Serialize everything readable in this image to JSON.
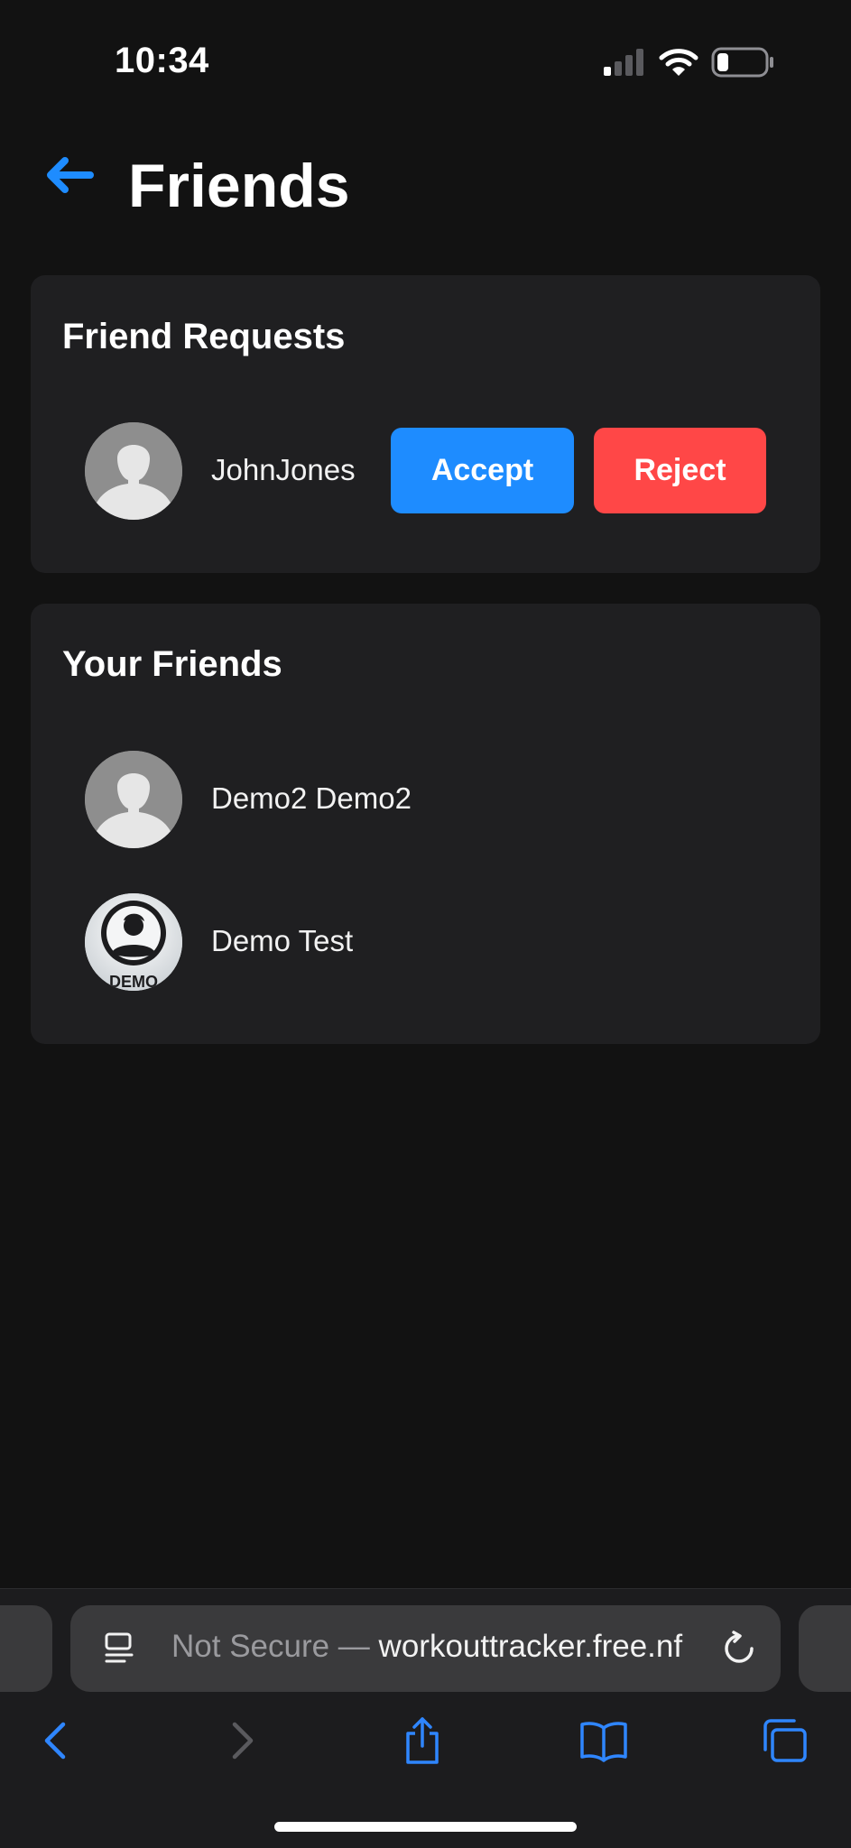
{
  "status_bar": {
    "time": "10:34"
  },
  "header": {
    "title": "Friends"
  },
  "friend_requests": {
    "title": "Friend Requests",
    "items": [
      {
        "name": "JohnJones",
        "accept_label": "Accept",
        "reject_label": "Reject"
      }
    ]
  },
  "friends": {
    "title": "Your Friends",
    "items": [
      {
        "name": "Demo2 Demo2",
        "avatar": "default-avatar"
      },
      {
        "name": "Demo Test",
        "avatar": "demo-avatar",
        "avatar_text": "DEMO"
      }
    ]
  },
  "browser": {
    "url_prefix": "Not Secure — ",
    "url_domain": "workouttracker.free.nf"
  },
  "colors": {
    "accent": "#1e8cff",
    "danger": "#ff4747",
    "card": "#1f1f21",
    "background": "#121212"
  }
}
